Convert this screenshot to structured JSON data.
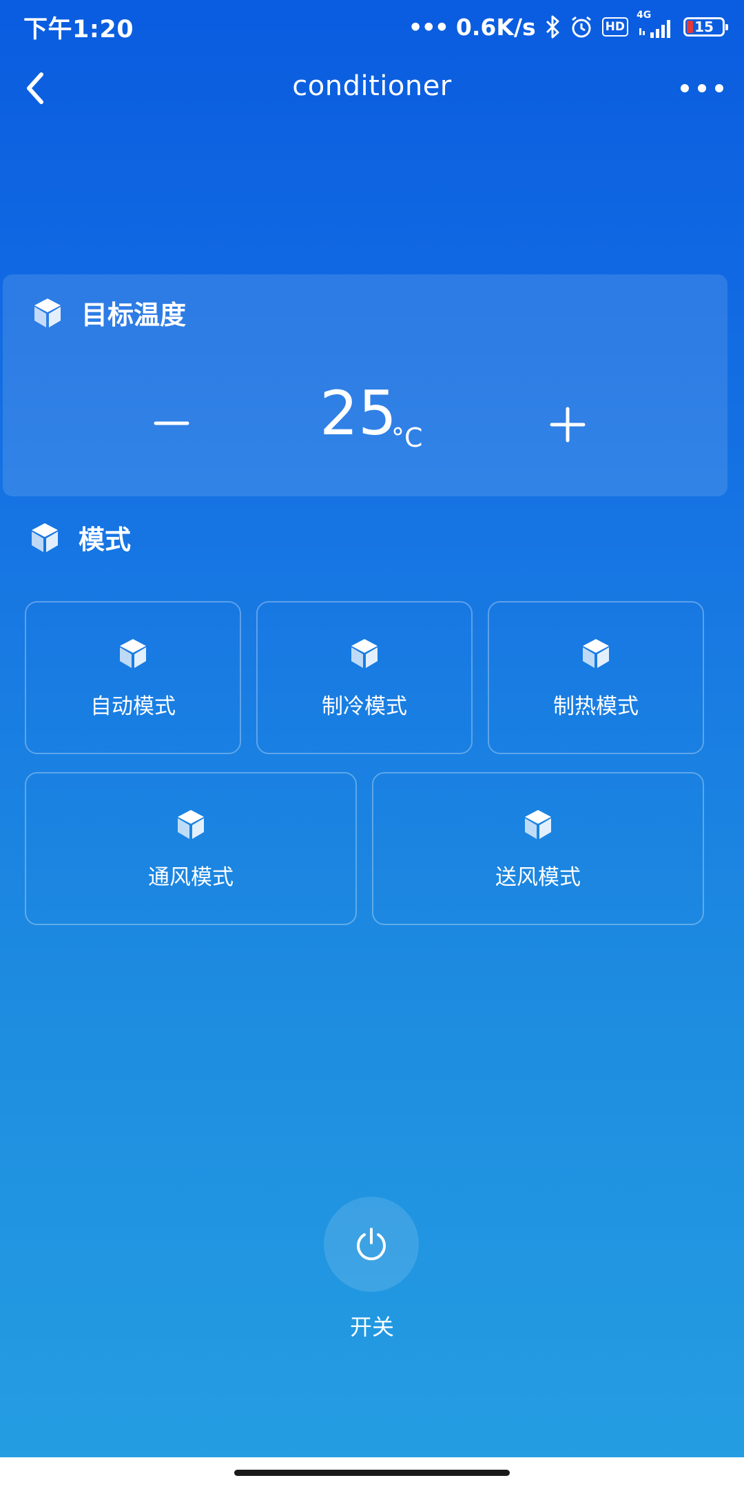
{
  "status_bar": {
    "time": "下午1:20",
    "dots": "•••",
    "net_speed": "0.6K/s",
    "hd_label": "HD",
    "network_label": "4G",
    "battery_level": "15",
    "icons": [
      "bluetooth-icon",
      "alarm-icon",
      "hd-icon",
      "signal-icon",
      "battery-icon"
    ]
  },
  "nav": {
    "title": "conditioner",
    "back_icon": "chevron-left-icon",
    "more_icon": "more-horizontal-icon"
  },
  "temperature": {
    "title": "目标温度",
    "value": "25",
    "unit": "°C",
    "decrease_icon": "minus-icon",
    "increase_icon": "plus-icon"
  },
  "mode": {
    "title": "模式",
    "items": [
      {
        "label": "自动模式",
        "icon": "cube-icon"
      },
      {
        "label": "制冷模式",
        "icon": "cube-icon"
      },
      {
        "label": "制热模式",
        "icon": "cube-icon"
      },
      {
        "label": "通风模式",
        "icon": "cube-icon"
      },
      {
        "label": "送风模式",
        "icon": "cube-icon"
      }
    ]
  },
  "power": {
    "label": "开关",
    "icon": "power-icon"
  },
  "colors": {
    "background_top": "#0a5ce0",
    "background_bottom": "#259ee2",
    "battery_low": "#e53935"
  }
}
